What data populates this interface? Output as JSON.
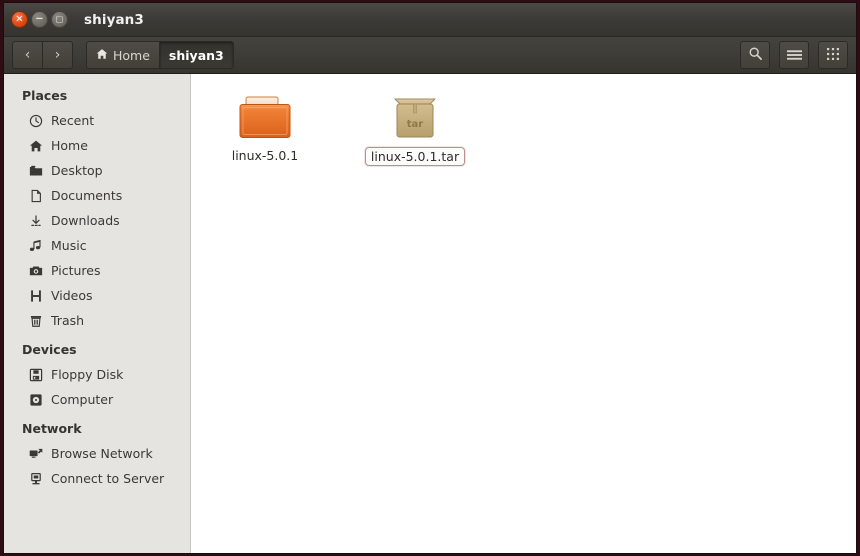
{
  "window": {
    "title": "shiyan3",
    "buttons": {
      "close": {
        "name": "close",
        "glyph": "×"
      },
      "minimize": {
        "name": "minimize",
        "glyph": "−"
      },
      "maximize": {
        "name": "maximize",
        "glyph": "□"
      }
    }
  },
  "toolbar": {
    "back_label": "‹",
    "forward_label": "›",
    "breadcrumbs": [
      {
        "label": "Home",
        "icon": "home-icon",
        "active": false
      },
      {
        "label": "shiyan3",
        "icon": "",
        "active": true
      }
    ],
    "search_icon": "search-icon",
    "menu_icon": "hamburger-menu-icon",
    "view_grid_icon": "grid-view-icon"
  },
  "sidebar": {
    "groups": [
      {
        "title": "Places",
        "items": [
          {
            "label": "Recent",
            "icon": "clock-icon"
          },
          {
            "label": "Home",
            "icon": "home-icon"
          },
          {
            "label": "Desktop",
            "icon": "folder-icon"
          },
          {
            "label": "Documents",
            "icon": "document-icon"
          },
          {
            "label": "Downloads",
            "icon": "download-icon"
          },
          {
            "label": "Music",
            "icon": "music-note-icon"
          },
          {
            "label": "Pictures",
            "icon": "camera-icon"
          },
          {
            "label": "Videos",
            "icon": "film-icon"
          },
          {
            "label": "Trash",
            "icon": "trash-icon"
          }
        ]
      },
      {
        "title": "Devices",
        "items": [
          {
            "label": "Floppy Disk",
            "icon": "floppy-disk-icon"
          },
          {
            "label": "Computer",
            "icon": "computer-disc-icon"
          }
        ]
      },
      {
        "title": "Network",
        "items": [
          {
            "label": "Browse Network",
            "icon": "network-browse-icon"
          },
          {
            "label": "Connect to Server",
            "icon": "server-connect-icon"
          }
        ]
      }
    ]
  },
  "content": {
    "files": [
      {
        "name": "linux-5.0.1",
        "type": "folder",
        "icon": "folder-icon",
        "editing": false
      },
      {
        "name": "linux-5.0.1.tar",
        "type": "archive",
        "icon": "archive-box-icon",
        "archive_badge": "tar",
        "editing": true
      }
    ]
  },
  "colors": {
    "titlebar": "#3c3a36",
    "toolbar": "#3e3c37",
    "sidebar_bg": "#e6e4e1",
    "content_bg": "#ffffff",
    "folder_orange": "#e8722c",
    "archive_tan": "#c3ab79",
    "close_button": "#dd4814",
    "rename_border": "#c08d8d",
    "desktop_frame": "#2b0d13"
  }
}
